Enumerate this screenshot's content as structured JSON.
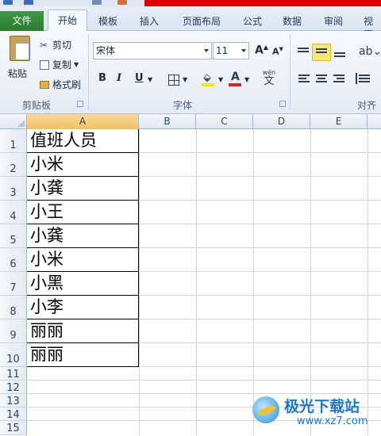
{
  "ribbon": {
    "tabs": {
      "file": "文件",
      "home": "开始",
      "template": "模板",
      "insert": "插入",
      "page_layout": "页面布局",
      "formula": "公式",
      "data": "数据",
      "review": "审阅",
      "view": "视图"
    },
    "clipboard": {
      "paste": "粘贴",
      "cut": "剪切",
      "copy": "复制",
      "format_painter": "格式刷",
      "group_label": "剪贴板"
    },
    "font": {
      "font_name": "宋体",
      "font_size": "11",
      "grow": "A",
      "shrink": "A",
      "bold": "B",
      "italic": "I",
      "underline": "U",
      "font_color_letter": "A",
      "phonetic": "wén",
      "group_label": "字体"
    },
    "alignment": {
      "group_label": "对齐方"
    }
  },
  "sheet": {
    "columns": [
      "A",
      "B",
      "C",
      "D",
      "E"
    ],
    "rows": [
      "1",
      "2",
      "3",
      "4",
      "5",
      "6",
      "7",
      "8",
      "9",
      "10",
      "11",
      "12",
      "13",
      "14",
      "15"
    ],
    "cells_A": [
      "值班人员",
      "小米",
      "小龚",
      "小王",
      "小龚",
      "小米",
      "小黑",
      "小李",
      "丽丽",
      "丽丽"
    ]
  },
  "watermark": {
    "title": "极光下载站",
    "url": "www.xz7.com"
  },
  "colors": {
    "file_tab": "#2b7a31",
    "title_red": "#e10000",
    "selected_header": "#f1c15f",
    "highlight_color": "#f4e400",
    "font_color": "#e02020"
  }
}
